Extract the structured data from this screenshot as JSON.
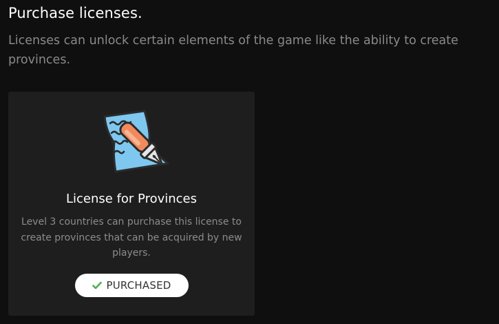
{
  "header": {
    "title": "Purchase licenses.",
    "subtitle": "Licenses can unlock certain elements of the game like the ability to create provinces."
  },
  "licenses": [
    {
      "title": "License for Provinces",
      "description": "Level 3 countries can purchase this license to create provinces that can be acquired by new players.",
      "icon": "document-pen-icon",
      "status_label": "PURCHASED",
      "status_icon": "check-icon",
      "status_color": "#4caf50"
    }
  ],
  "colors": {
    "background": "#0f0f0f",
    "card": "#1e1e1e",
    "paper": "#7ec8f0",
    "pen_body": "#f08a5d"
  }
}
